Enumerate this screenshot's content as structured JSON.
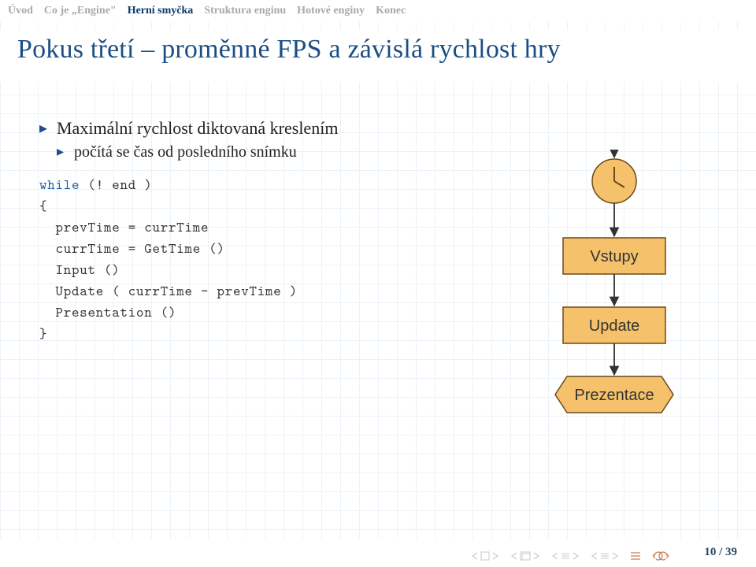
{
  "nav": {
    "items": [
      {
        "label": "Úvod",
        "active": false
      },
      {
        "label": "Co je „Engine\"",
        "active": false
      },
      {
        "label": "Herní smyčka",
        "active": true
      },
      {
        "label": "Struktura enginu",
        "active": false
      },
      {
        "label": "Hotové enginy",
        "active": false
      },
      {
        "label": "Konec",
        "active": false
      }
    ]
  },
  "title": "Pokus třetí – proměnné FPS a závislá rychlost hry",
  "bullets": {
    "b1": "Maximální rychlost diktovaná kreslením",
    "b1a": "počítá se čas od posledního snímku"
  },
  "code": {
    "kw_while": "while",
    "cond": "(! end )",
    "l2": "{",
    "l3": "  prevTime = currTime",
    "l4": "  currTime = GetTime ()",
    "l5": "  Input ()",
    "l6": "  Update ( currTime - prevTime )",
    "l7": "  Presentation ()",
    "l8": "}"
  },
  "diagram": {
    "n1": "Vstupy",
    "n2": "Update",
    "n3": "Prezentace"
  },
  "footer": {
    "page": "10 / 39"
  },
  "colors": {
    "accent": "#1a4e85",
    "box_fill": "#f5c26b",
    "box_stroke": "#6b4a1a",
    "nav_symbol": "#c77a47"
  }
}
